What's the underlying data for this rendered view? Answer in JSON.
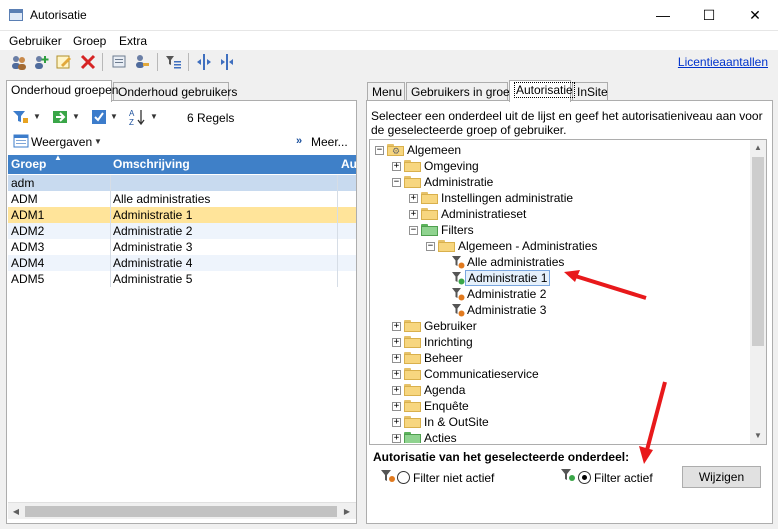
{
  "window": {
    "title": "Autorisatie",
    "minimize_glyph": "—",
    "maximize_glyph": "☐",
    "close_glyph": "✕"
  },
  "menu": [
    "Gebruiker",
    "Groep",
    "Extra"
  ],
  "toolbar": {
    "license_link": "Licentieaantallen",
    "icons": [
      "users-icon",
      "add-user-icon",
      "edit-icon",
      "delete-icon",
      "print-icon",
      "key-icon",
      "filter-list-icon",
      "split-icon",
      "split-horizontal-icon"
    ]
  },
  "left_tabs": [
    {
      "label": "Onderhoud groepen",
      "active": true
    },
    {
      "label": "Onderhoud gebruikers",
      "active": false
    }
  ],
  "left_toolbar": {
    "row_count": "6 Regels",
    "views_label": "Weergaven",
    "more_label": "Meer..."
  },
  "grid": {
    "columns": [
      "Groep",
      "Omschrijving",
      "Au"
    ],
    "filter_value": "adm",
    "rows": [
      {
        "groep": "ADM",
        "omschrijving": "Alle administraties",
        "selected": false
      },
      {
        "groep": "ADM1",
        "omschrijving": "Administratie 1",
        "selected": true
      },
      {
        "groep": "ADM2",
        "omschrijving": "Administratie 2",
        "selected": false
      },
      {
        "groep": "ADM3",
        "omschrijving": "Administratie 3",
        "selected": false
      },
      {
        "groep": "ADM4",
        "omschrijving": "Administratie 4",
        "selected": false
      },
      {
        "groep": "ADM5",
        "omschrijving": "Administratie 5",
        "selected": false
      }
    ]
  },
  "right_tabs": [
    {
      "label": "Menu",
      "active": false
    },
    {
      "label": "Gebruikers in groep",
      "active": false
    },
    {
      "label": "Autorisatie",
      "active": true
    },
    {
      "label": "InSite",
      "active": false
    }
  ],
  "right_desc": "Selecteer een onderdeel uit de lijst en geef het autorisatieniveau aan voor de geselecteerde groep of gebruiker.",
  "tree": [
    {
      "label": "Algemeen",
      "level": 0,
      "expander": "−",
      "icon": "gear-folder-icon"
    },
    {
      "label": "Omgeving",
      "level": 1,
      "expander": "+",
      "icon": "folder"
    },
    {
      "label": "Administratie",
      "level": 1,
      "expander": "−",
      "icon": "folder"
    },
    {
      "label": "Instellingen administratie",
      "level": 2,
      "expander": "+",
      "icon": "folder"
    },
    {
      "label": "Administratieset",
      "level": 2,
      "expander": "+",
      "icon": "folder"
    },
    {
      "label": "Filters",
      "level": 2,
      "expander": "−",
      "icon": "green-folder"
    },
    {
      "label": "Algemeen - Administraties",
      "level": 3,
      "expander": "−",
      "icon": "folder"
    },
    {
      "label": "Alle administraties",
      "level": 4,
      "expander": "",
      "icon": "funnel-orange"
    },
    {
      "label": "Administratie 1",
      "level": 4,
      "expander": "",
      "icon": "funnel-green",
      "selected": true
    },
    {
      "label": "Administratie 2",
      "level": 4,
      "expander": "",
      "icon": "funnel-orange"
    },
    {
      "label": "Administratie 3",
      "level": 4,
      "expander": "",
      "icon": "funnel-orange"
    },
    {
      "label": "Gebruiker",
      "level": 1,
      "expander": "+",
      "icon": "folder"
    },
    {
      "label": "Inrichting",
      "level": 1,
      "expander": "+",
      "icon": "folder"
    },
    {
      "label": "Beheer",
      "level": 1,
      "expander": "+",
      "icon": "folder"
    },
    {
      "label": "Communicatieservice",
      "level": 1,
      "expander": "+",
      "icon": "folder"
    },
    {
      "label": "Agenda",
      "level": 1,
      "expander": "+",
      "icon": "folder"
    },
    {
      "label": "Enquête",
      "level": 1,
      "expander": "+",
      "icon": "folder"
    },
    {
      "label": "In & OutSite",
      "level": 1,
      "expander": "+",
      "icon": "folder"
    },
    {
      "label": "Acties",
      "level": 1,
      "expander": "+",
      "icon": "green-folder"
    }
  ],
  "authorization": {
    "section_label": "Autorisatie van het geselecteerde onderdeel:",
    "option_inactive": "Filter niet actief",
    "option_active": "Filter actief",
    "selected": "Filter actief",
    "change_button": "Wijzigen"
  },
  "colors": {
    "header_blue": "#3f80c8",
    "selected_row": "#ffe49a",
    "arrow_red": "#e8191b",
    "link_blue": "#0033cc"
  }
}
